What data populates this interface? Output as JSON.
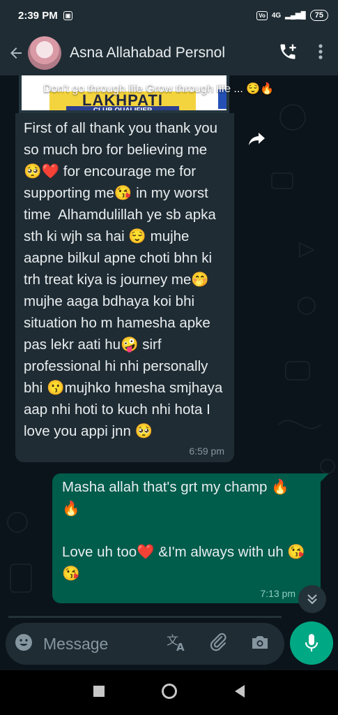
{
  "status_bar": {
    "time": "2:39 PM",
    "network": "4G",
    "battery": "75"
  },
  "header": {
    "contact_name": "Asna Allahabad Persnol"
  },
  "chat": {
    "image_banner": "LAKHPATI",
    "image_sub": "CLUB QUALIFIER",
    "image_caption": "Don't go through life Grow through life ... 😌🔥",
    "incoming_text": "First of all thank you thank you so much bro for believing me 🥺❤️ for encourage me for supporting me😘 in my worst time  Alhamdulillah ye sb apka sth ki wjh sa hai 😌 mujhe aapne bilkul apne choti bhn ki trh treat kiya is journey me🤭 mujhe aaga bdhaya koi bhi situation ho m hamesha apke pas lekr aati hu🤪 sirf professional hi nhi personally bhi 😗mujhko hmesha smjhaya aap nhi hoti to kuch nhi hota I love you appi jnn 🥺",
    "incoming_time": "6:59 pm",
    "outgoing_text": "Masha allah that's grt my champ 🔥 🔥\n\nLove uh too❤️ &I'm always with uh 😘😘",
    "outgoing_time": "7:13 pm"
  },
  "composer": {
    "placeholder": "Message"
  },
  "icons": {
    "back": "back-arrow-icon",
    "call": "add-call-icon",
    "menu": "more-vert-icon",
    "forward": "forward-icon",
    "emoji": "emoji-icon",
    "translate": "translate-icon",
    "attach": "attach-icon",
    "camera": "camera-icon",
    "mic": "mic-icon"
  },
  "colors": {
    "header": "#1f2c34",
    "incoming_bubble": "#1f2c34",
    "outgoing_bubble": "#005c4b",
    "accent": "#00a884"
  }
}
